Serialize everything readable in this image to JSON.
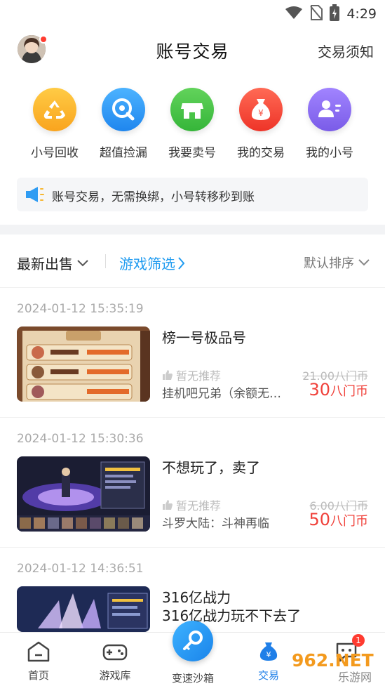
{
  "status_bar": {
    "time": "4:29"
  },
  "header": {
    "title": "账号交易",
    "notice_label": "交易须知"
  },
  "quick_actions": [
    {
      "label": "小号回收",
      "icon": "recycle-icon",
      "color": "#fbb42a"
    },
    {
      "label": "超值捡漏",
      "icon": "magnifier-icon",
      "color": "#2f9cf3"
    },
    {
      "label": "我要卖号",
      "icon": "shop-icon",
      "color": "#48c447"
    },
    {
      "label": "我的交易",
      "icon": "money-bag-icon",
      "color": "#f64b3c"
    },
    {
      "label": "我的小号",
      "icon": "user-card-icon",
      "color": "#8b6bf0"
    }
  ],
  "announcement": {
    "text": "账号交易，无需换绑，小号转移秒到账"
  },
  "filters": {
    "latest": "最新出售",
    "game_filter": "游戏筛选",
    "sort": "默认排序"
  },
  "listings": [
    {
      "time": "2024-01-12 15:35:19",
      "title": "榜一号极品号",
      "recommend": "暂无推荐",
      "original_price": "21.00八门币",
      "subtitle": "挂机吧兄弟（余额无…",
      "price": "30",
      "price_unit": "八门币"
    },
    {
      "time": "2024-01-12 15:30:36",
      "title": "不想玩了，卖了",
      "recommend": "暂无推荐",
      "original_price": "6.00八门币",
      "subtitle": "斗罗大陆：斗神再临",
      "price": "50",
      "price_unit": "八门币"
    },
    {
      "time": "2024-01-12 14:36:51",
      "title": "316亿战力\n316亿战力玩不下去了"
    }
  ],
  "bottom_nav": {
    "home": "首页",
    "library": "游戏库",
    "sandbox": "变速沙箱",
    "trade": "交易",
    "message_badge": "1"
  },
  "watermark": {
    "brand": "962.NET",
    "sub": "乐游网"
  },
  "colors": {
    "accent": "#1f9bf0",
    "price": "#f0413a",
    "nav_active": "#1f7fe8"
  }
}
